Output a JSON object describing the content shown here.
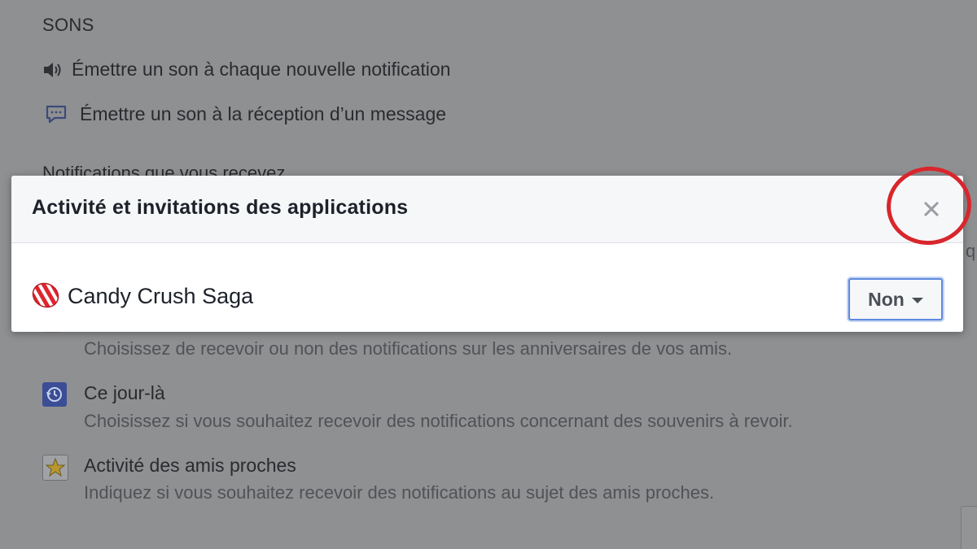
{
  "background": {
    "sounds": {
      "heading": "SONS",
      "items": [
        {
          "label": "Émettre un son à chaque nouvelle notification",
          "icon": "speaker-icon"
        },
        {
          "label": "Émettre un son à la réception d’un message",
          "icon": "message-bubble-icon"
        }
      ]
    },
    "cut_heading": "Notifications que vous recevez",
    "right_fragment": "q",
    "settings": [
      {
        "title": "",
        "description": "Choisissez de recevoir ou non des notifications sur les anniversaires de vos amis.",
        "icon": "birthday-icon"
      },
      {
        "title": "Ce jour-là",
        "description": "Choisissez si vous souhaitez recevoir des notifications concernant des souvenirs à revoir.",
        "icon": "on-this-day-icon"
      },
      {
        "title": "Activité des amis proches",
        "description": "Indiquez si vous souhaitez recevoir des notifications au sujet des amis proches.",
        "icon": "star-icon"
      }
    ]
  },
  "dialog": {
    "title": "Activité et invitations des applications",
    "close_icon": "close-icon",
    "apps": [
      {
        "name": "Candy Crush Saga",
        "icon": "candy-crush-icon",
        "setting": "Non"
      }
    ]
  },
  "colors": {
    "overlay": "#8f9092",
    "highlight_circle": "#d8262c",
    "select_border": "#5b8ae0"
  }
}
